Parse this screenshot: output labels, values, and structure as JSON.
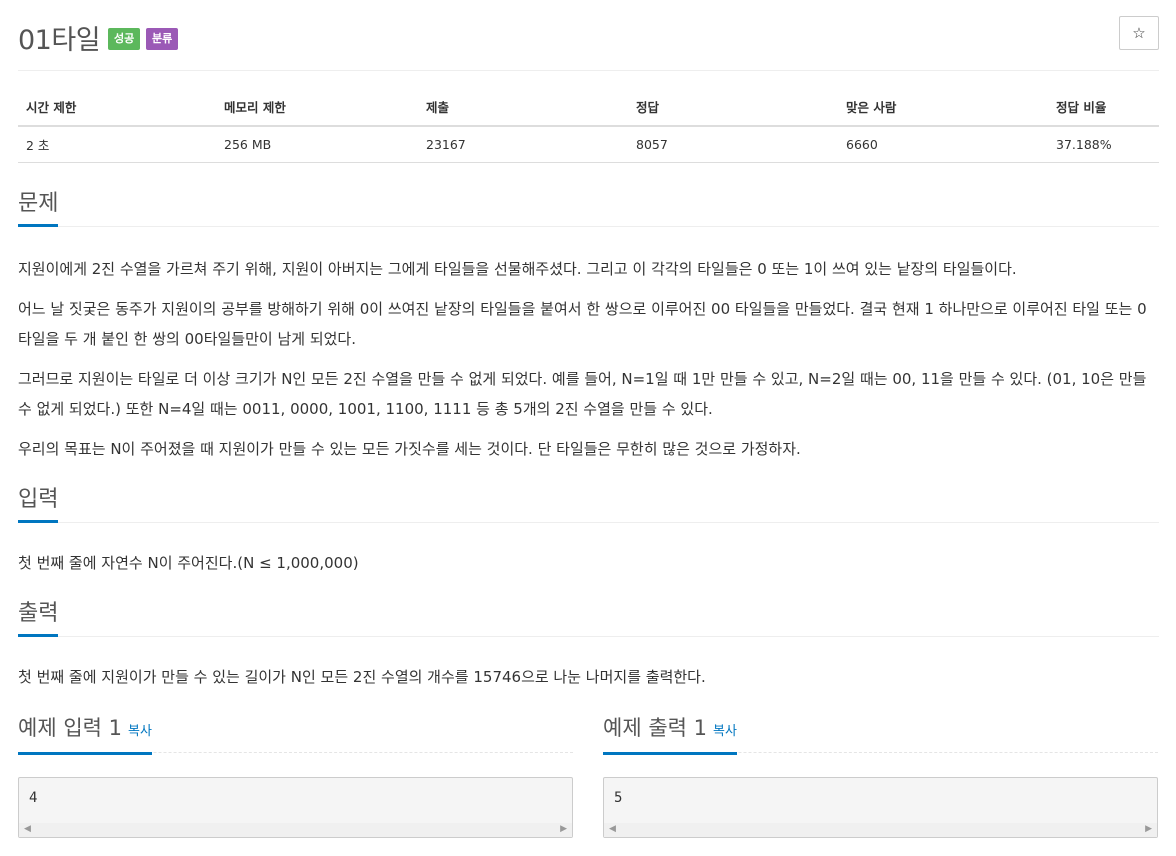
{
  "problem": {
    "title": "01타일",
    "badges": [
      "성공",
      "분류"
    ],
    "star_icon": "☆"
  },
  "info_table": {
    "headers": [
      "시간 제한",
      "메모리 제한",
      "제출",
      "정답",
      "맞은 사람",
      "정답 비율"
    ],
    "values": [
      "2 초",
      "256 MB",
      "23167",
      "8057",
      "6660",
      "37.188%"
    ]
  },
  "sections": {
    "problem": {
      "title": "문제",
      "paragraphs": [
        "지원이에게 2진 수열을 가르쳐 주기 위해, 지원이 아버지는 그에게 타일들을 선물해주셨다. 그리고 이 각각의 타일들은 0 또는 1이 쓰여 있는 낱장의 타일들이다.",
        "어느 날 짓궂은 동주가 지원이의 공부를 방해하기 위해 0이 쓰여진 낱장의 타일들을 붙여서 한 쌍으로 이루어진 00 타일들을 만들었다. 결국 현재 1 하나만으로 이루어진 타일 또는 0타일을 두 개 붙인 한 쌍의 00타일들만이 남게 되었다.",
        "그러므로 지원이는 타일로 더 이상 크기가 N인 모든 2진 수열을 만들 수 없게 되었다. 예를 들어, N=1일 때 1만 만들 수 있고, N=2일 때는 00, 11을 만들 수 있다. (01, 10은 만들 수 없게 되었다.) 또한 N=4일 때는 0011, 0000, 1001, 1100, 1111 등 총 5개의 2진 수열을 만들 수 있다.",
        "우리의 목표는 N이 주어졌을 때 지원이가 만들 수 있는 모든 가짓수를 세는 것이다. 단 타일들은 무한히 많은 것으로 가정하자."
      ]
    },
    "input": {
      "title": "입력",
      "text": "첫 번째 줄에 자연수 N이 주어진다.(N ≤ 1,000,000)"
    },
    "output": {
      "title": "출력",
      "text": "첫 번째 줄에 지원이가 만들 수 있는 길이가 N인 모든 2진 수열의 개수를 15746으로 나눈 나머지를 출력한다."
    }
  },
  "examples": {
    "input": {
      "title": "예제 입력 1",
      "copy": "복사",
      "value": "4"
    },
    "output": {
      "title": "예제 출력 1",
      "copy": "복사",
      "value": "5"
    }
  },
  "colors": {
    "accent": "#0076c0",
    "success_badge": "#5cb85c",
    "category_badge": "#9b59b6"
  }
}
